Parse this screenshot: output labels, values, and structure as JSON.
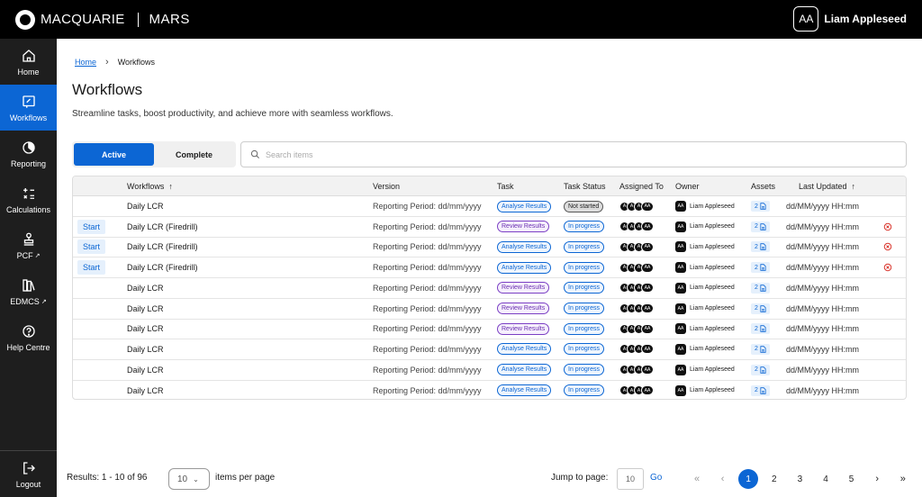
{
  "header": {
    "brand": "MACQUARIE",
    "app": "MARS",
    "user_initials": "AA",
    "user_name": "Liam Appleseed"
  },
  "sidebar": {
    "items": [
      {
        "label": "Home",
        "icon": "home-icon"
      },
      {
        "label": "Workflows",
        "icon": "workflow-icon",
        "active": true
      },
      {
        "label": "Reporting",
        "icon": "pie-chart-icon"
      },
      {
        "label": "Calculations",
        "icon": "calculator-icon"
      },
      {
        "label": "PCF",
        "icon": "stamp-icon",
        "external": true
      },
      {
        "label": "EDMCS",
        "icon": "books-icon",
        "external": true
      },
      {
        "label": "Help Centre",
        "icon": "help-icon"
      }
    ],
    "logout": "Logout"
  },
  "breadcrumb": {
    "home": "Home",
    "current": "Workflows"
  },
  "page": {
    "title": "Workflows",
    "description": "Streamline tasks, boost productivity, and achieve more with seamless workflows."
  },
  "tabs": {
    "active": "Active",
    "complete": "Complete"
  },
  "search": {
    "placeholder": "Search items"
  },
  "table": {
    "headers": {
      "workflows": "Workflows",
      "version": "Version",
      "task": "Task",
      "status": "Task Status",
      "assigned": "Assigned To",
      "owner": "Owner",
      "assets": "Assets",
      "updated": "Last Updated"
    },
    "rows": [
      {
        "start": "",
        "workflow": "Daily LCR",
        "version": "Reporting Period: dd/mm/yyyy",
        "task": "Analyse Results",
        "task_type": "analyse",
        "status": "Not started",
        "status_type": "notstarted",
        "assigned": [
          "A",
          "A",
          "A",
          "AA"
        ],
        "owner_initials": "AA",
        "owner": "Liam Appleseed",
        "assets": "2",
        "updated": "dd/MM/yyyy HH:mm",
        "cancel": false
      },
      {
        "start": "Start",
        "workflow": "Daily LCR (Firedrill)",
        "version": "Reporting Period: dd/mm/yyyy",
        "task": "Review Results",
        "task_type": "review",
        "status": "In progress",
        "status_type": "progress",
        "assigned": [
          "A",
          "A",
          "A",
          "AA"
        ],
        "owner_initials": "AA",
        "owner": "Liam Appleseed",
        "assets": "2",
        "updated": "dd/MM/yyyy HH:mm",
        "cancel": true
      },
      {
        "start": "Start",
        "workflow": "Daily LCR (Firedrill)",
        "version": "Reporting Period: dd/mm/yyyy",
        "task": "Analyse Results",
        "task_type": "analyse",
        "status": "In progress",
        "status_type": "progress",
        "assigned": [
          "A",
          "A",
          "A",
          "AA"
        ],
        "owner_initials": "AA",
        "owner": "Liam Appleseed",
        "assets": "2",
        "updated": "dd/MM/yyyy HH:mm",
        "cancel": true
      },
      {
        "start": "Start",
        "workflow": "Daily LCR (Firedrill)",
        "version": "Reporting Period: dd/mm/yyyy",
        "task": "Analyse Results",
        "task_type": "analyse",
        "status": "In progress",
        "status_type": "progress",
        "assigned": [
          "A",
          "A",
          "A",
          "AA"
        ],
        "owner_initials": "AA",
        "owner": "Liam Appleseed",
        "assets": "2",
        "updated": "dd/MM/yyyy HH:mm",
        "cancel": true
      },
      {
        "start": "",
        "workflow": "Daily LCR",
        "version": "Reporting Period: dd/mm/yyyy",
        "task": "Review Results",
        "task_type": "review",
        "status": "In progress",
        "status_type": "progress",
        "assigned": [
          "A",
          "A",
          "A",
          "AA"
        ],
        "owner_initials": "AA",
        "owner": "Liam Appleseed",
        "assets": "2",
        "updated": "dd/MM/yyyy HH:mm",
        "cancel": false
      },
      {
        "start": "",
        "workflow": "Daily LCR",
        "version": "Reporting Period: dd/mm/yyyy",
        "task": "Review Results",
        "task_type": "review",
        "status": "In progress",
        "status_type": "progress",
        "assigned": [
          "A",
          "A",
          "A",
          "AA"
        ],
        "owner_initials": "AA",
        "owner": "Liam Appleseed",
        "assets": "2",
        "updated": "dd/MM/yyyy HH:mm",
        "cancel": false
      },
      {
        "start": "",
        "workflow": "Daily LCR",
        "version": "Reporting Period: dd/mm/yyyy",
        "task": "Review Results",
        "task_type": "review",
        "status": "In progress",
        "status_type": "progress",
        "assigned": [
          "A",
          "A",
          "A",
          "AA"
        ],
        "owner_initials": "AA",
        "owner": "Liam Appleseed",
        "assets": "2",
        "updated": "dd/MM/yyyy HH:mm",
        "cancel": false
      },
      {
        "start": "",
        "workflow": "Daily LCR",
        "version": "Reporting Period: dd/mm/yyyy",
        "task": "Analyse Results",
        "task_type": "analyse",
        "status": "In progress",
        "status_type": "progress",
        "assigned": [
          "A",
          "A",
          "A",
          "AA"
        ],
        "owner_initials": "AA",
        "owner": "Liam Appleseed",
        "assets": "2",
        "updated": "dd/MM/yyyy HH:mm",
        "cancel": false
      },
      {
        "start": "",
        "workflow": "Daily LCR",
        "version": "Reporting Period: dd/mm/yyyy",
        "task": "Analyse Results",
        "task_type": "analyse",
        "status": "In progress",
        "status_type": "progress",
        "assigned": [
          "A",
          "A",
          "A",
          "AA"
        ],
        "owner_initials": "AA",
        "owner": "Liam Appleseed",
        "assets": "2",
        "updated": "dd/MM/yyyy HH:mm",
        "cancel": false
      },
      {
        "start": "",
        "workflow": "Daily LCR",
        "version": "Reporting Period: dd/mm/yyyy",
        "task": "Analyse Results",
        "task_type": "analyse",
        "status": "In progress",
        "status_type": "progress",
        "assigned": [
          "A",
          "A",
          "A",
          "AA"
        ],
        "owner_initials": "AA",
        "owner": "Liam Appleseed",
        "assets": "2",
        "updated": "dd/MM/yyyy HH:mm",
        "cancel": false
      }
    ]
  },
  "footer": {
    "results": "Results: 1 - 10 of 96",
    "per_page_value": "10",
    "per_page_label": "items per page",
    "jump_label": "Jump to page:",
    "jump_value": "10",
    "go": "Go",
    "pages": [
      "1",
      "2",
      "3",
      "4",
      "5"
    ],
    "current_page": "1"
  },
  "colors": {
    "accent": "#0c66d4",
    "topbar": "#000000",
    "sidebar": "#1e1e1e",
    "cancel": "#d9342b"
  }
}
